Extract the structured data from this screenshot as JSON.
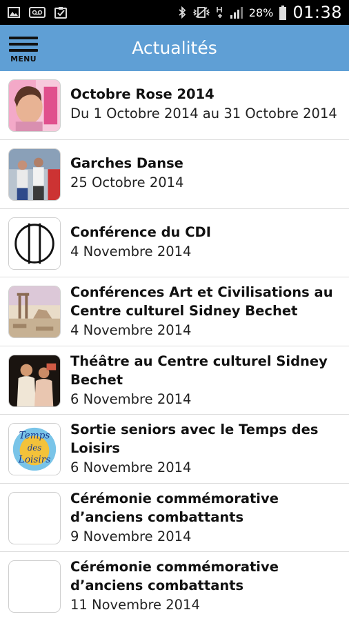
{
  "status_bar": {
    "icons_left": [
      "image-icon",
      "voicemail-icon",
      "clipboard-check-icon"
    ],
    "icons_right": [
      "bluetooth-icon",
      "vibrate-icon",
      "hplus-signal-icon",
      "cell-signal-icon"
    ],
    "battery_percent": "28%",
    "time": "01:38"
  },
  "header": {
    "menu_label": "MENU",
    "title": "Actualités",
    "background_color": "#5f9fd5"
  },
  "news": [
    {
      "title": "Octobre Rose 2014",
      "date": "Du 1 Octobre 2014 au 31 Octobre 2014",
      "thumbnail": "pink-portrait"
    },
    {
      "title": "Garches Danse",
      "date": "25 Octobre 2014",
      "thumbnail": "dancers-photo"
    },
    {
      "title": "Conférence du CDI",
      "date": "4 Novembre 2014",
      "thumbnail": "cdi-logo"
    },
    {
      "title": "Conférences Art et Civilisations au Centre culturel Sidney Bechet",
      "date": "4 Novembre 2014",
      "thumbnail": "ruins-painting"
    },
    {
      "title": "Théâtre au Centre culturel Sidney Bechet",
      "date": "6 Novembre 2014",
      "thumbnail": "theatre-photo"
    },
    {
      "title": "Sortie seniors avec le Temps des Loisirs",
      "date": "6 Novembre 2014",
      "thumbnail": "temps-des-loisirs-logo",
      "thumbnail_text": "Temps des Loisirs"
    },
    {
      "title": "Cérémonie commémorative d’anciens combattants",
      "date": "9 Novembre 2014",
      "thumbnail": "blank"
    },
    {
      "title": "Cérémonie commémorative d’anciens combattants",
      "date": "11 Novembre 2014",
      "thumbnail": "blank"
    }
  ]
}
